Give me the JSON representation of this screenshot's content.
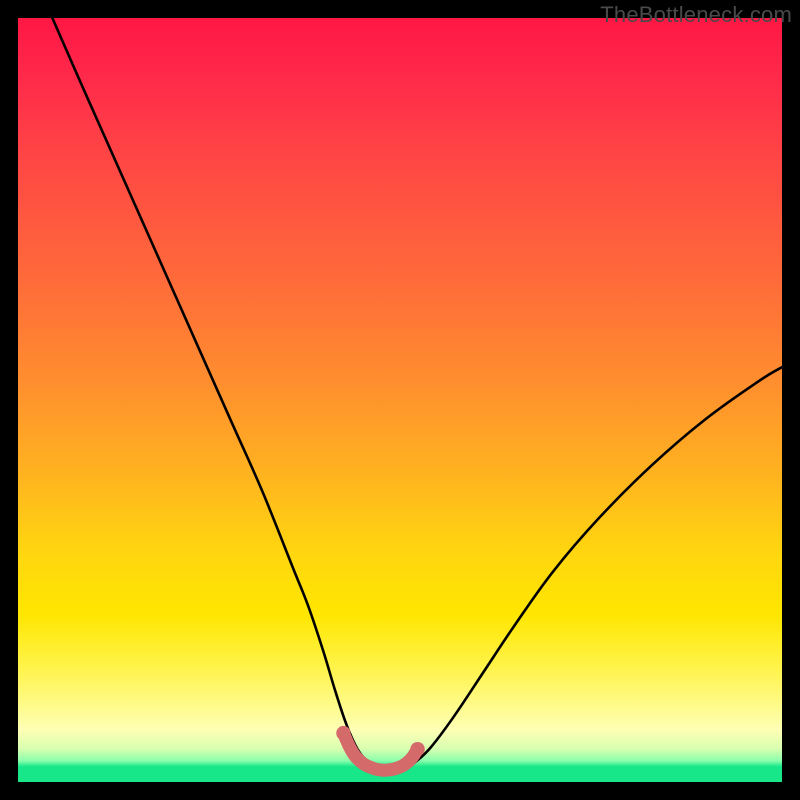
{
  "watermark": {
    "text": "TheBottleneck.com"
  },
  "colors": {
    "background": "#000000",
    "gradient_top": "#ff1744",
    "gradient_mid": "#ffd60f",
    "gradient_bottom": "#17e788",
    "curve_stroke": "#000000",
    "valley_stroke": "#d46a6a"
  },
  "chart_data": {
    "type": "line",
    "title": "",
    "xlabel": "",
    "ylabel": "",
    "xlim": [
      0,
      100
    ],
    "ylim": [
      0,
      100
    ],
    "grid": false,
    "legend": false,
    "annotations": [
      "TheBottleneck.com"
    ],
    "series": [
      {
        "name": "main-curve",
        "x": [
          4.5,
          8,
          12,
          16,
          20,
          24,
          28,
          32,
          36,
          38,
          40,
          41.5,
          43,
          44.5,
          46,
          47,
          48,
          49,
          50,
          51,
          52,
          54,
          57,
          61,
          65,
          70,
          76,
          83,
          90,
          97,
          100
        ],
        "y": [
          100,
          92,
          83,
          74,
          65,
          56,
          47,
          38,
          28,
          23,
          17,
          12,
          7.5,
          4.2,
          2.4,
          1.8,
          1.5,
          1.5,
          1.6,
          1.9,
          2.6,
          4.5,
          8.5,
          14.5,
          20.5,
          27.5,
          34.5,
          41.5,
          47.5,
          52.5,
          54.3
        ]
      },
      {
        "name": "valley-highlight",
        "x": [
          42.6,
          43.4,
          44.2,
          45.2,
          46.2,
          47.2,
          48.2,
          49.2,
          50.2,
          50.9,
          51.6,
          52.3
        ],
        "y": [
          6.4,
          4.6,
          3.3,
          2.4,
          1.9,
          1.6,
          1.55,
          1.7,
          2.05,
          2.5,
          3.2,
          4.3
        ]
      }
    ]
  }
}
